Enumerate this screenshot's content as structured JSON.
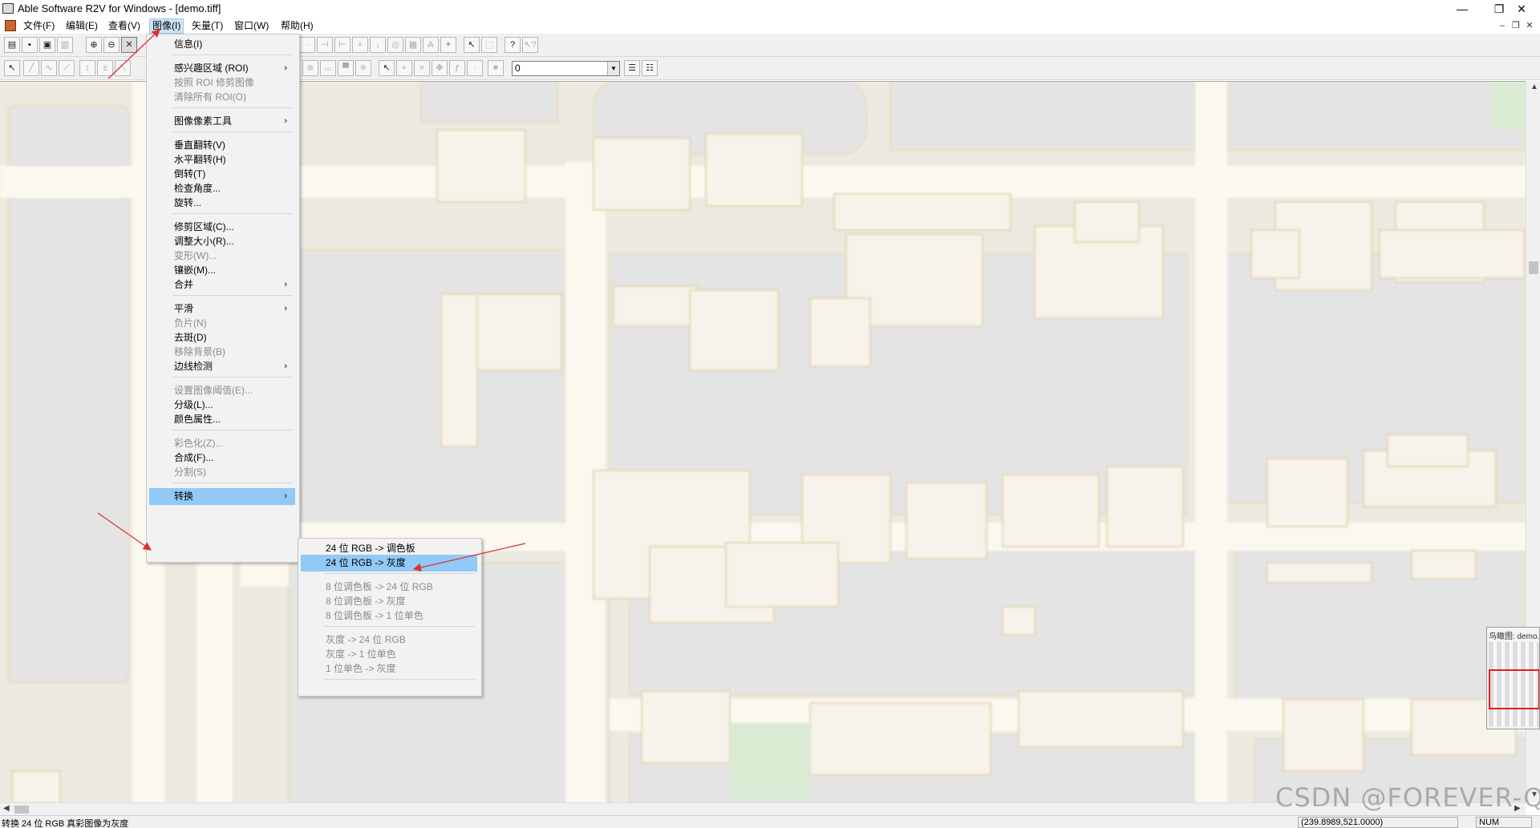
{
  "window": {
    "title": "Able Software R2V for Windows - [demo.tiff]",
    "controls": [
      "—",
      "❐",
      "✕"
    ]
  },
  "menubar": {
    "items": [
      "文件(F)",
      "编辑(E)",
      "查看(V)",
      "图像(I)",
      "矢量(T)",
      "窗口(W)",
      "帮助(H)"
    ],
    "active_index": 3,
    "mdi_controls": [
      "–",
      "❐",
      "✕"
    ]
  },
  "toolbar": {
    "combo_value": "0"
  },
  "image_menu": {
    "items": [
      {
        "label": "信息(I)",
        "enabled": true
      },
      {
        "label": "感兴趣区域 (ROI)",
        "enabled": true,
        "submenu": true
      },
      {
        "label": "按照 ROI 修剪图像",
        "enabled": false
      },
      {
        "label": "清除所有 ROI(O)",
        "enabled": false
      },
      {
        "label": "图像像素工具",
        "enabled": true,
        "submenu": true
      },
      {
        "label": "垂直翻转(V)",
        "enabled": true
      },
      {
        "label": "水平翻转(H)",
        "enabled": true
      },
      {
        "label": "倒转(T)",
        "enabled": true
      },
      {
        "label": "检查角度...",
        "enabled": true
      },
      {
        "label": "旋转...",
        "enabled": true
      },
      {
        "label": "修剪区域(C)...",
        "enabled": true
      },
      {
        "label": "调整大小(R)...",
        "enabled": true
      },
      {
        "label": "变形(W)...",
        "enabled": false
      },
      {
        "label": "镶嵌(M)...",
        "enabled": true
      },
      {
        "label": "合并",
        "enabled": true,
        "submenu": true
      },
      {
        "label": "平滑",
        "enabled": true,
        "submenu": true
      },
      {
        "label": "负片(N)",
        "enabled": false
      },
      {
        "label": "去斑(D)",
        "enabled": true
      },
      {
        "label": "移除背景(B)",
        "enabled": false
      },
      {
        "label": "边线检测",
        "enabled": true,
        "submenu": true
      },
      {
        "label": "设置图像阈值(E)...",
        "enabled": false
      },
      {
        "label": "分级(L)...",
        "enabled": true
      },
      {
        "label": "颜色属性...",
        "enabled": true
      },
      {
        "label": "彩色化(Z)...",
        "enabled": false
      },
      {
        "label": "合成(F)...",
        "enabled": true
      },
      {
        "label": "分割(S)",
        "enabled": false
      },
      {
        "label": "转换",
        "enabled": true,
        "submenu": true,
        "highlighted": true
      }
    ]
  },
  "convert_submenu": {
    "items": [
      {
        "label": "24 位 RGB -> 调色板",
        "enabled": true
      },
      {
        "label": "24 位 RGB -> 灰度",
        "enabled": true,
        "highlighted": true
      },
      {
        "label": "8 位调色板 -> 24 位 RGB",
        "enabled": false
      },
      {
        "label": "8 位调色板 -> 灰度",
        "enabled": false
      },
      {
        "label": "8 位调色板 -> 1 位单色",
        "enabled": false
      },
      {
        "label": "灰度 -> 24 位 RGB",
        "enabled": false
      },
      {
        "label": "灰度 -> 1 位单色",
        "enabled": false
      },
      {
        "label": "1 位单色 -> 灰度",
        "enabled": false
      }
    ]
  },
  "overview": {
    "title": "鸟瞰图: demo.tiff"
  },
  "statusbar": {
    "message": "转换 24 位 RGB 真彩图像为灰度",
    "coords": "(239.8989,521.0000)",
    "num": "NUM"
  },
  "watermark": "CSDN @FOREVER-Q",
  "colors": {
    "menu_highlight": "#91c9f7",
    "annotation_arrow": "#e03030",
    "map_road": "#fbf8f0",
    "map_block": "#e6e6e6",
    "map_building": "#f5f3ea",
    "map_park": "#d9ecd3"
  }
}
